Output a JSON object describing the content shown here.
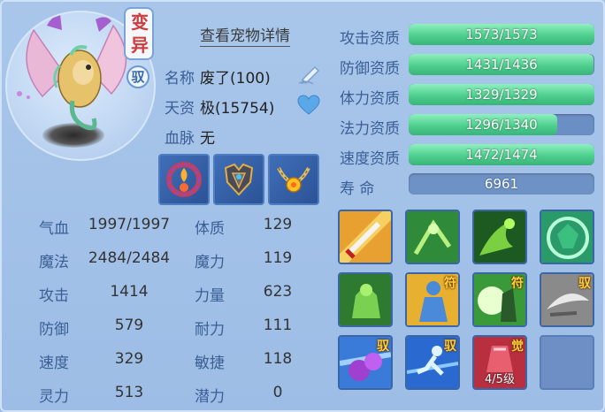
{
  "badges": {
    "variant": "变异",
    "tamed": "驭"
  },
  "detail_link": "查看宠物详情",
  "info": {
    "name_label": "名称",
    "name_value": "废了(100)",
    "talent_label": "天资",
    "talent_value": "极(15754)",
    "bloodline_label": "血脉",
    "bloodline_value": "无"
  },
  "equipment": [
    {
      "icon": "flame-collar-icon"
    },
    {
      "icon": "armor-icon"
    },
    {
      "icon": "amulet-icon"
    }
  ],
  "stats": [
    {
      "label": "气血",
      "value": "1997/1997",
      "label2": "体质",
      "value2": "129"
    },
    {
      "label": "魔法",
      "value": "2484/2484",
      "label2": "魔力",
      "value2": "119"
    },
    {
      "label": "攻击",
      "value": "1414",
      "label2": "力量",
      "value2": "623"
    },
    {
      "label": "防御",
      "value": "579",
      "label2": "耐力",
      "value2": "111"
    },
    {
      "label": "速度",
      "value": "329",
      "label2": "敏捷",
      "value2": "118"
    },
    {
      "label": "灵力",
      "value": "513",
      "label2": "潜力",
      "value2": "0"
    }
  ],
  "aptitudes": [
    {
      "label": "攻击资质",
      "text": "1573/1573",
      "fill": 1.0
    },
    {
      "label": "防御资质",
      "text": "1431/1436",
      "fill": 0.9965
    },
    {
      "label": "体力资质",
      "text": "1329/1329",
      "fill": 1.0
    },
    {
      "label": "法力资质",
      "text": "1296/1340",
      "fill": 0.8
    },
    {
      "label": "速度资质",
      "text": "1472/1474",
      "fill": 0.9986
    }
  ],
  "lifespan": {
    "label": "寿    命",
    "value": "6961"
  },
  "skills": [
    {
      "icon": "sword-strike-icon",
      "tag": "",
      "level": ""
    },
    {
      "icon": "multi-attack-icon",
      "tag": "",
      "level": ""
    },
    {
      "icon": "shadow-claw-icon",
      "tag": "",
      "level": ""
    },
    {
      "icon": "green-grab-icon",
      "tag": "",
      "level": ""
    },
    {
      "icon": "strength-icon",
      "tag": "",
      "level": ""
    },
    {
      "icon": "golden-body-icon",
      "tag": "符",
      "level": ""
    },
    {
      "icon": "warrior-moon-icon",
      "tag": "符",
      "level": ""
    },
    {
      "icon": "grey-blade-icon",
      "tag": "驭",
      "level": ""
    },
    {
      "icon": "purple-fist-icon",
      "tag": "驭",
      "level": ""
    },
    {
      "icon": "running-icon",
      "tag": "驭",
      "level": ""
    },
    {
      "icon": "awaken-icon",
      "tag": "觉",
      "level": "4/5级"
    },
    {
      "icon": "empty-slot",
      "tag": "",
      "level": ""
    }
  ],
  "colors": {
    "bar_fill": "#4fcf8f",
    "bar_track": "#6b8fc4",
    "label": "#3a5f95",
    "badge_red": "#d03a3a",
    "tag_gold": "#ffcf3a"
  }
}
